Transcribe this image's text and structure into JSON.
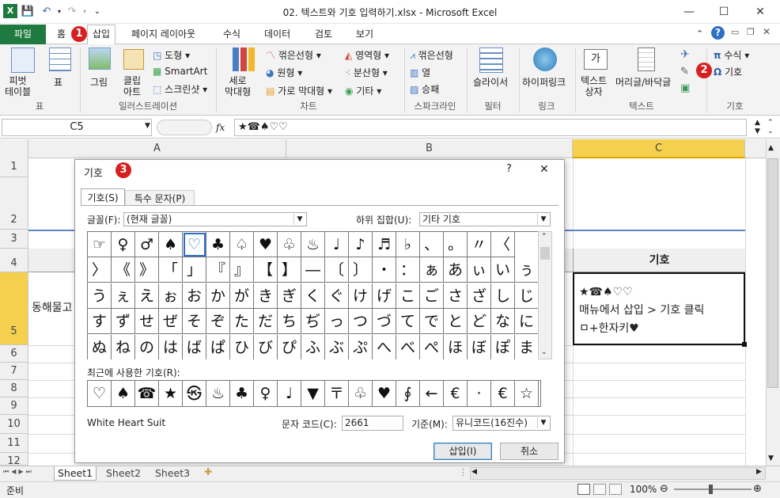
{
  "window": {
    "title": "02. 텍스트와 기호 입력하기.xlsx - Microsoft Excel"
  },
  "tabs": {
    "file": "파일",
    "home": "홈",
    "insert": "삽입",
    "page_layout": "페이지 레이아웃",
    "formulas": "수식",
    "data": "데이터",
    "review": "검토",
    "view": "보기"
  },
  "ribbon": {
    "pivot": "피벗\n테이블",
    "table": "표",
    "picture": "그림",
    "clipart": "클립\n아트",
    "shapes": "도형",
    "smartart": "SmartArt",
    "screenshot": "스크린샷",
    "column": "세로\n막대형",
    "line": "꺾은선형",
    "pie": "원형",
    "bar": "가로 막대형",
    "area": "영역형",
    "scatter": "분산형",
    "other": "기타",
    "sp_line": "꺾은선형",
    "sp_col": "열",
    "sp_winloss": "승패",
    "slicer": "슬라이서",
    "hyperlink": "하이퍼링크",
    "textbox": "텍스트\n상자",
    "headerfooter": "머리글/바닥글",
    "equation": "수식",
    "symbol": "기호",
    "groups": {
      "tables": "표",
      "illustrations": "일러스트레이션",
      "charts": "차트",
      "sparklines": "스파크라인",
      "filter": "필터",
      "links": "링크",
      "text": "텍스트",
      "symbols": "기호"
    }
  },
  "formula_bar": {
    "name_box": "C5",
    "fx": "fx",
    "content": "★☎♠♡♡"
  },
  "columns": [
    "A",
    "B",
    "C"
  ],
  "rows": [
    "1",
    "2",
    "3",
    "4",
    "5",
    "6",
    "7",
    "8",
    "9",
    "10",
    "11",
    "12"
  ],
  "cells": {
    "a5": "동해물고",
    "c4": "기호",
    "c5_line1": "★☎♠♡♡",
    "c5_line2": "매뉴에서 삽입 > 기호 클릭",
    "c5_line3": "ㅁ+한자키♥"
  },
  "badges": [
    "1",
    "2",
    "3"
  ],
  "dialog": {
    "title": "기호",
    "help": "?",
    "close": "✕",
    "tab_symbols": "기호(S)",
    "tab_special": "특수 문자(P)",
    "font_label": "글꼴(F):",
    "font_value": "(현재 글꼴)",
    "subset_label": "하위 집합(U):",
    "subset_value": "기타 기호",
    "grid": [
      [
        "☞",
        "♀",
        "♂",
        "♠",
        "♡",
        "♣",
        "♤",
        "♥",
        "♧",
        "♨",
        "♩",
        "♪",
        "♬",
        "♭",
        "、",
        "。",
        "〃",
        "〈"
      ],
      [
        "〉",
        "《",
        "》",
        "「",
        "」",
        "『",
        "』",
        "【",
        "】",
        "―",
        "〔",
        "〕",
        "・",
        "：",
        "ぁ",
        "あ",
        "ぃ",
        "い",
        "ぅ"
      ],
      [
        "う",
        "ぇ",
        "え",
        "ぉ",
        "お",
        "か",
        "が",
        "き",
        "ぎ",
        "く",
        "ぐ",
        "け",
        "げ",
        "こ",
        "ご",
        "さ",
        "ざ",
        "し",
        "じ"
      ],
      [
        "す",
        "ず",
        "せ",
        "ぜ",
        "そ",
        "ぞ",
        "た",
        "だ",
        "ち",
        "ぢ",
        "っ",
        "つ",
        "づ",
        "て",
        "で",
        "と",
        "ど",
        "な",
        "に"
      ],
      [
        "ぬ",
        "ね",
        "の",
        "は",
        "ば",
        "ぱ",
        "ひ",
        "び",
        "ぴ",
        "ふ",
        "ぶ",
        "ぷ",
        "へ",
        "べ",
        "ぺ",
        "ほ",
        "ぼ",
        "ぽ",
        "ま"
      ]
    ],
    "recent_label": "최근에 사용한 기호(R):",
    "recent": [
      "♡",
      "♠",
      "☎",
      "★",
      "㉿",
      "♨",
      "♣",
      "♀",
      "♩",
      "▼",
      "〒",
      "♧",
      "♥",
      "∮",
      "←",
      "€",
      "·",
      "€",
      "☆"
    ],
    "char_name": "White Heart Suit",
    "code_label": "문자 코드(C):",
    "code_value": "2661",
    "from_label": "기준(M):",
    "from_value": "유니코드(16진수)",
    "insert": "삽입(I)",
    "cancel": "취소"
  },
  "sheets": [
    "Sheet1",
    "Sheet2",
    "Sheet3"
  ],
  "status": {
    "ready": "준비",
    "zoom": "100%"
  }
}
